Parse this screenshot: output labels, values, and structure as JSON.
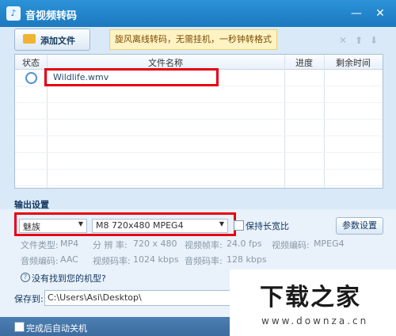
{
  "window": {
    "title": "音视频转码",
    "min_glyph": "—",
    "close_glyph": "✕"
  },
  "toolbar": {
    "add_file_label": "添加文件",
    "tip": "旋风离线转码，无需挂机，一秒钟转格式",
    "delete_glyph": "✕",
    "up_glyph": "⬆",
    "down_glyph": "⬇"
  },
  "table": {
    "columns": [
      "状态",
      "文件名称",
      "进度",
      "剩余时间"
    ],
    "rows": [
      {
        "filename": "Wildlife.wmv",
        "progress": "",
        "remaining": ""
      }
    ]
  },
  "output": {
    "section_title": "输出设置",
    "brand": "魅族",
    "model": "M8 720x480 MPEG4",
    "keep_ratio_label": "保持长宽比",
    "params_button": "参数设置",
    "info": {
      "file_type_label": "文件类型:",
      "file_type": "MP4",
      "resolution_label": "分 辨 率:",
      "resolution": "720 x 480",
      "video_fps_label": "视频帧率:",
      "video_fps": "24.0 fps",
      "video_codec_label": "视频编码:",
      "video_codec": "MPEG4",
      "audio_codec_label": "音频编码:",
      "audio_codec": "AAC",
      "video_bitrate_label": "视频码率:",
      "video_bitrate": "1024 kbps",
      "audio_bitrate_label": "音频码率:",
      "audio_bitrate": "128 kbps"
    },
    "missing_model_link": "没有找到您的机型?",
    "save_to_label": "保存到:",
    "save_path": "C:\\Users\\Asi\\Desktop\\"
  },
  "footer": {
    "shutdown_label": "完成后自动关机"
  },
  "watermark": {
    "text": "下载之家",
    "url": "www.downza.cn"
  },
  "colors": {
    "accent": "#1b78bf",
    "highlight": "#e60012"
  }
}
